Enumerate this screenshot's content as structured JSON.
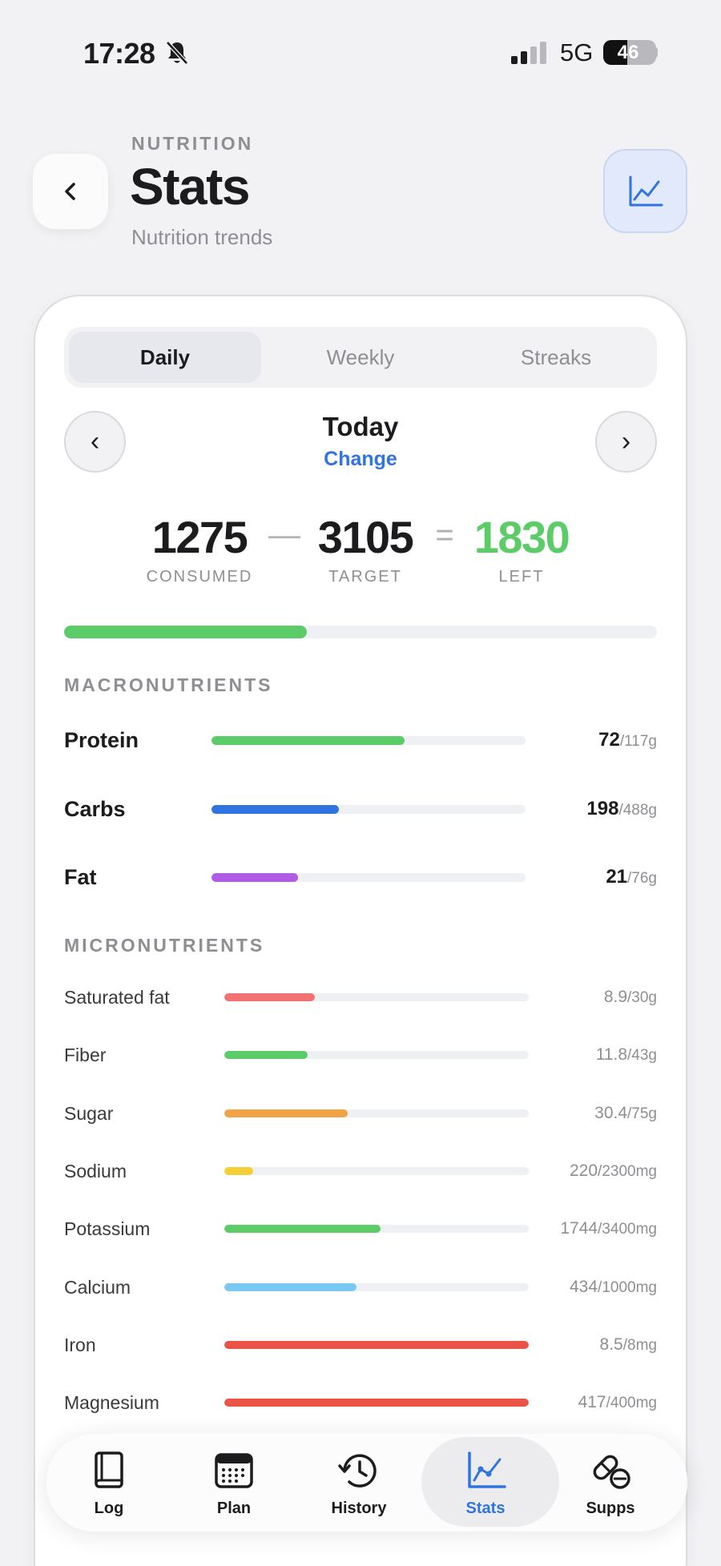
{
  "status_bar": {
    "time": "17:28",
    "network": "5G",
    "battery": "46",
    "battery_level": 0.46
  },
  "header": {
    "eyebrow": "NUTRITION",
    "title": "Stats",
    "subtitle": "Nutrition trends"
  },
  "segments": [
    {
      "label": "Daily",
      "active": true
    },
    {
      "label": "Weekly",
      "active": false
    },
    {
      "label": "Streaks",
      "active": false
    }
  ],
  "date_nav": {
    "prev": "‹",
    "next": "›",
    "label": "Today",
    "change": "Change"
  },
  "summary": {
    "consumed": "1275",
    "consumed_label": "CONSUMED",
    "minus": "—",
    "target": "3105",
    "target_label": "TARGET",
    "equals": "=",
    "left": "1830",
    "left_label": "LEFT",
    "progress": 0.41,
    "progress_color": "#5ccc68"
  },
  "macronutrients": {
    "title": "MACRONUTRIENTS",
    "items": [
      {
        "label": "Protein",
        "value": "72",
        "target": "/117g",
        "fraction": 0.615,
        "color": "#5ccc68"
      },
      {
        "label": "Carbs",
        "value": "198",
        "target": "/488g",
        "fraction": 0.406,
        "color": "#2f74e0"
      },
      {
        "label": "Fat",
        "value": "21",
        "target": "/76g",
        "fraction": 0.276,
        "color": "#b05ce6"
      }
    ]
  },
  "micronutrients": {
    "title": "MICRONUTRIENTS",
    "items": [
      {
        "label": "Saturated fat",
        "value": "8.9",
        "target": "/30g",
        "fraction": 0.297,
        "color": "#f07272"
      },
      {
        "label": "Fiber",
        "value": "11.8",
        "target": "/43g",
        "fraction": 0.274,
        "color": "#5ccc68"
      },
      {
        "label": "Sugar",
        "value": "30.4",
        "target": "/75g",
        "fraction": 0.405,
        "color": "#f0a445"
      },
      {
        "label": "Sodium",
        "value": "220",
        "target": "/2300mg",
        "fraction": 0.096,
        "color": "#f5cf3a"
      },
      {
        "label": "Potassium",
        "value": "1744",
        "target": "/3400mg",
        "fraction": 0.513,
        "color": "#5ccc68"
      },
      {
        "label": "Calcium",
        "value": "434",
        "target": "/1000mg",
        "fraction": 0.434,
        "color": "#79c8f3"
      },
      {
        "label": "Iron",
        "value": "8.5",
        "target": "/8mg",
        "fraction": 1.0,
        "color": "#ea5346"
      },
      {
        "label": "Magnesium",
        "value": "417",
        "target": "/400mg",
        "fraction": 1.0,
        "color": "#ea5346"
      }
    ]
  },
  "tabbar": {
    "items": [
      {
        "label": "Log",
        "icon": "book-icon",
        "active": false
      },
      {
        "label": "Plan",
        "icon": "calendar-icon",
        "active": false
      },
      {
        "label": "History",
        "icon": "history-icon",
        "active": false
      },
      {
        "label": "Stats",
        "icon": "chart-icon",
        "active": true
      },
      {
        "label": "Supps",
        "icon": "pill-icon",
        "active": false
      }
    ],
    "accent": "#2f74e0"
  }
}
